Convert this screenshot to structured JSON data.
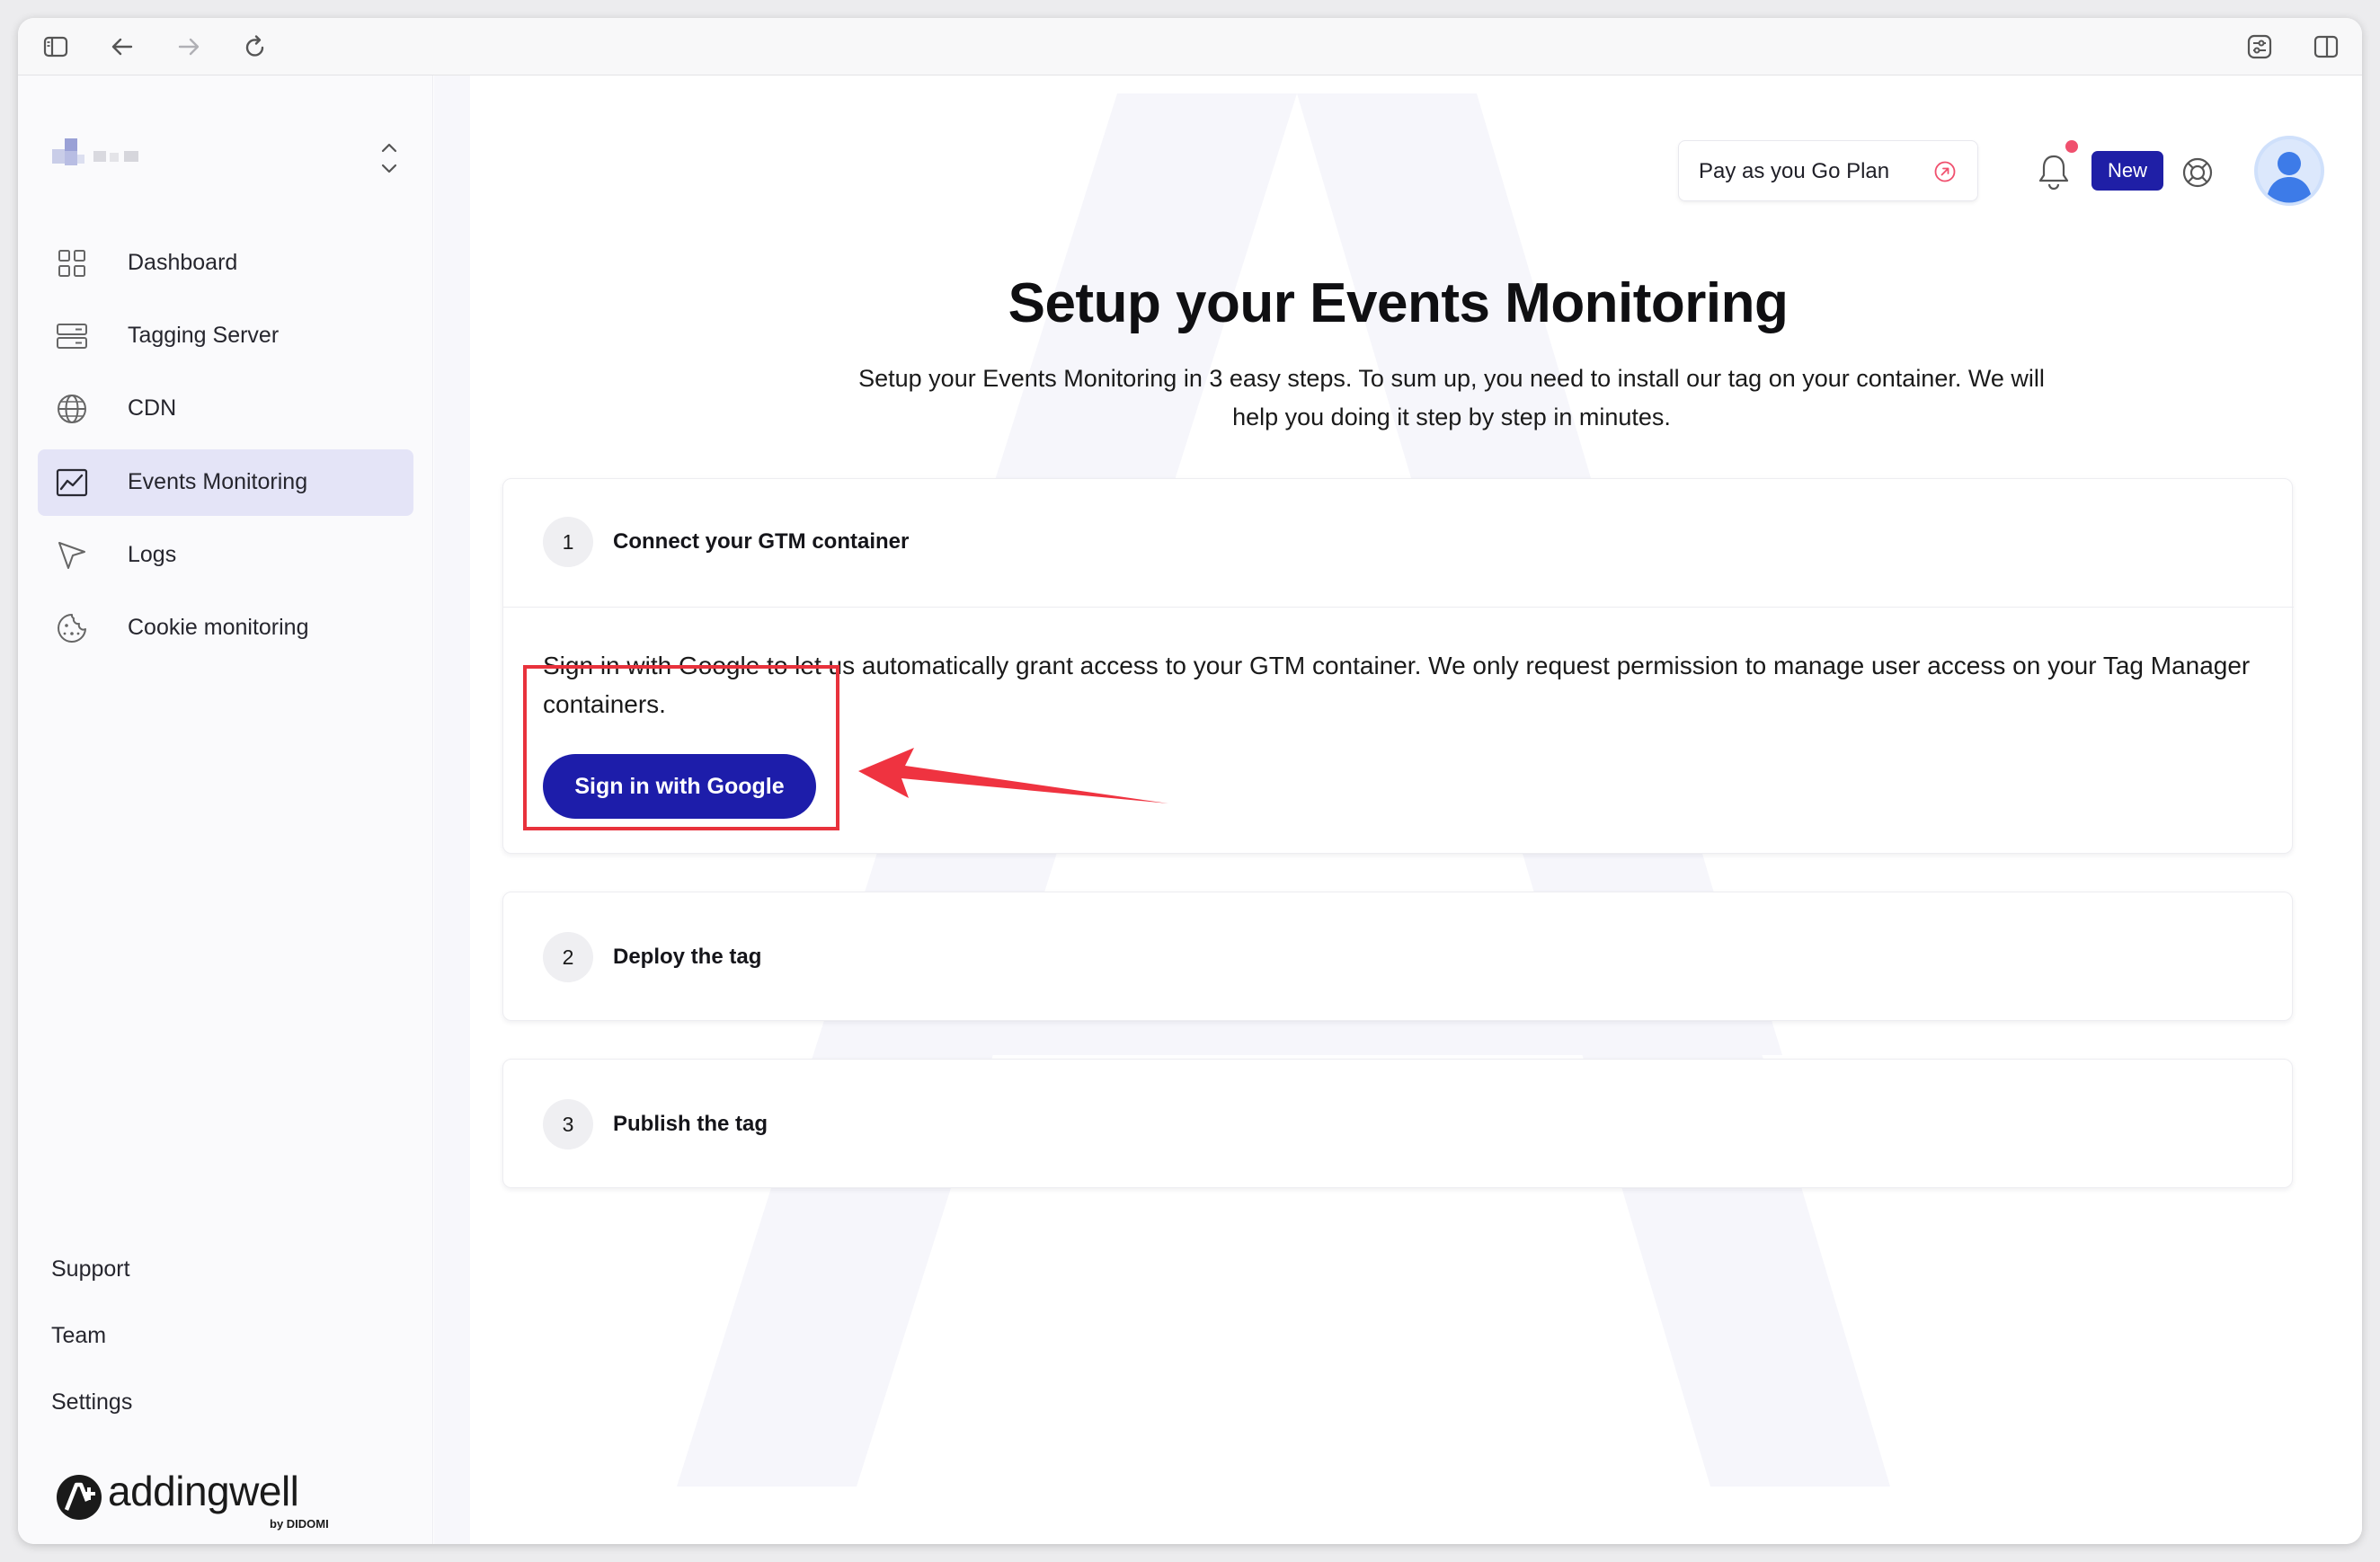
{
  "colors": {
    "accent": "#1d1daa",
    "active_nav": "#e4e4f7",
    "notification_dot": "#f0506e",
    "annotation_red": "#e8323c",
    "avatar_blue": "#3d7be8"
  },
  "browser_toolbar": {
    "icons": [
      "sidebar-toggle-icon",
      "back-arrow-icon",
      "forward-arrow-icon",
      "reload-icon",
      "settings-sliders-icon",
      "split-view-icon"
    ]
  },
  "sidebar": {
    "items": [
      {
        "label": "Dashboard",
        "icon": "grid-icon",
        "active": false
      },
      {
        "label": "Tagging Server",
        "icon": "server-icon",
        "active": false
      },
      {
        "label": "CDN",
        "icon": "globe-icon",
        "active": false
      },
      {
        "label": "Events Monitoring",
        "icon": "chart-line-icon",
        "active": true
      },
      {
        "label": "Logs",
        "icon": "cursor-arrow-icon",
        "active": false
      },
      {
        "label": "Cookie monitoring",
        "icon": "cookie-icon",
        "active": false
      }
    ],
    "bottom_links": [
      "Support",
      "Team",
      "Settings"
    ],
    "brand": {
      "name": "addingwell",
      "by": "by DIDOMI"
    }
  },
  "header": {
    "plan_label": "Pay as you Go Plan",
    "new_badge": "New"
  },
  "main": {
    "title": "Setup your Events Monitoring",
    "subtitle": "Setup your Events Monitoring in 3 easy steps. To sum up, you need to install our tag on your container. We will help you doing it step by step in minutes.",
    "steps": [
      {
        "number": "1",
        "title": "Connect your GTM container",
        "description": "Sign in with Google to let us automatically grant access to your GTM container. We only request permission to manage user access on your Tag Manager containers.",
        "button_label": "Sign in with Google"
      },
      {
        "number": "2",
        "title": "Deploy the tag"
      },
      {
        "number": "3",
        "title": "Publish the tag"
      }
    ]
  }
}
